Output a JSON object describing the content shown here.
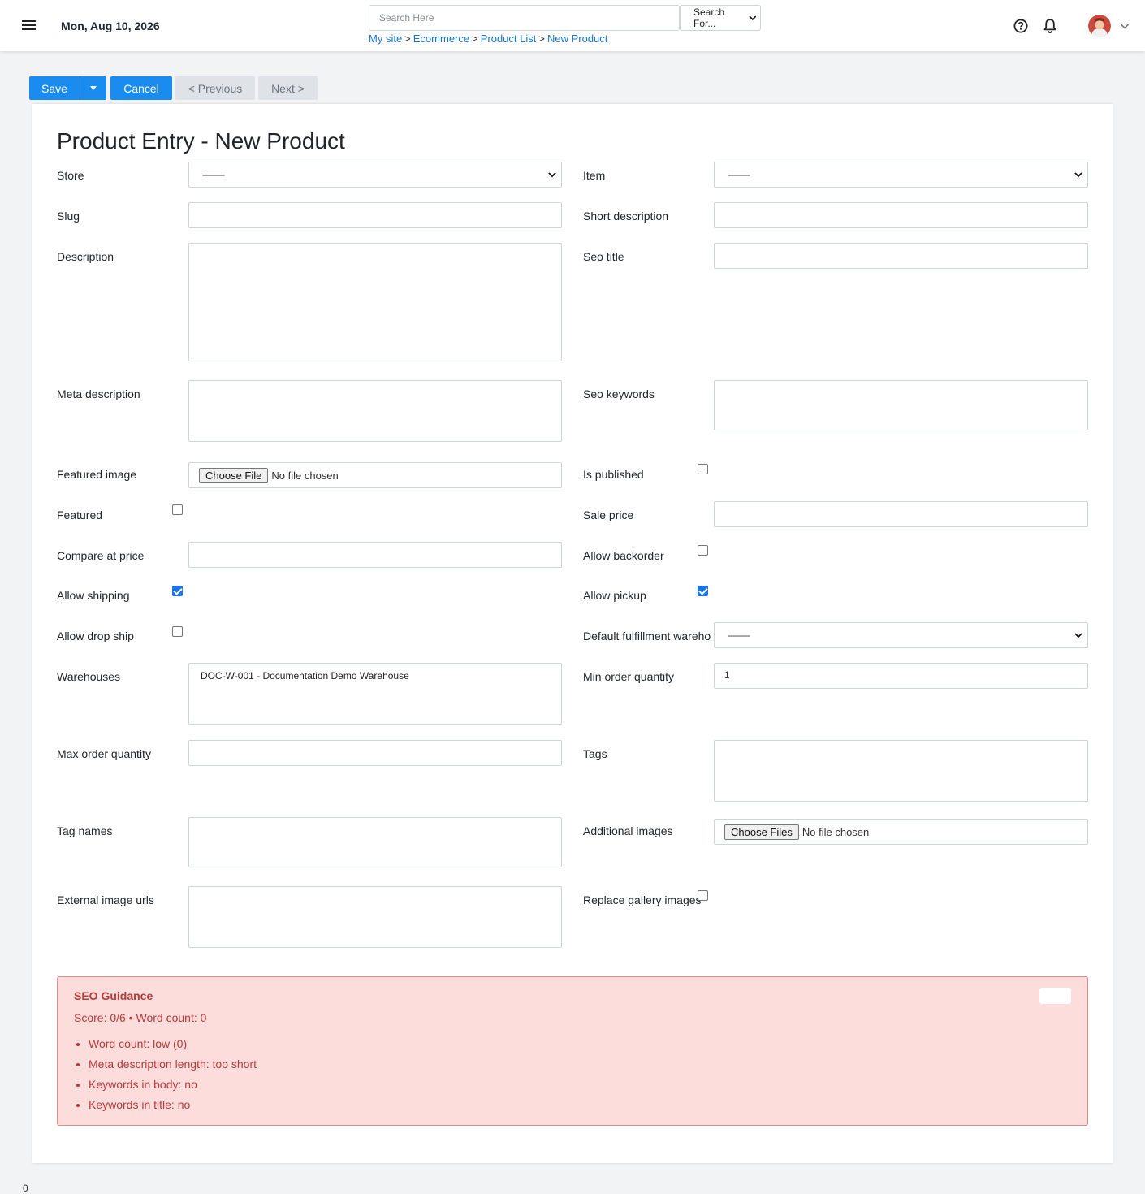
{
  "header": {
    "date": "Mon, Aug 10, 2026",
    "search_placeholder": "Search Here",
    "search_scope": "Search For...",
    "breadcrumb": [
      "My site",
      "Ecommerce",
      "Product List",
      "New Product"
    ],
    "breadcrumb_separator": ">"
  },
  "toolbar": {
    "save": "Save",
    "cancel": "Cancel",
    "previous": "< Previous",
    "next": "Next >"
  },
  "form": {
    "title": "Product Entry - New Product",
    "select_placeholder": "---------",
    "file_button": "Choose File",
    "files_button": "Choose Files",
    "no_file": "No file chosen",
    "labels": {
      "store": "Store",
      "item": "Item",
      "slug": "Slug",
      "short_description": "Short description",
      "description": "Description",
      "seo_title": "Seo title",
      "meta_description": "Meta description",
      "seo_keywords": "Seo keywords",
      "featured_image": "Featured image",
      "is_published": "Is published",
      "featured": "Featured",
      "sale_price": "Sale price",
      "compare_at_price": "Compare at price",
      "allow_backorder": "Allow backorder",
      "allow_shipping": "Allow shipping",
      "allow_pickup": "Allow pickup",
      "allow_drop_ship": "Allow drop ship",
      "default_fulfillment_warehouse": "Default fulfillment wareho",
      "warehouses": "Warehouses",
      "min_order_quantity": "Min order quantity",
      "max_order_quantity": "Max order quantity",
      "tags": "Tags",
      "tag_names": "Tag names",
      "additional_images": "Additional images",
      "external_image_urls": "External image urls",
      "replace_gallery_images": "Replace gallery images"
    },
    "values": {
      "warehouse_option": "DOC-W-001 - Documentation Demo Warehouse",
      "min_order_quantity": "1"
    },
    "checkboxes": {
      "is_published": false,
      "featured": false,
      "allow_backorder": false,
      "allow_shipping": true,
      "allow_pickup": true,
      "allow_drop_ship": false,
      "replace_gallery_images": false
    }
  },
  "seo": {
    "title": "SEO Guidance",
    "score_line": "Score: 0/6 • Word count: 0",
    "items": [
      "Word count: low (0)",
      "Meta description length: too short",
      "Keywords in body: no",
      "Keywords in title: no"
    ]
  },
  "footer_mark": "0",
  "colors": {
    "primary": "#1a8cf0",
    "link": "#1a73c9",
    "danger_bg": "#fddcdc",
    "danger_border": "#e08a8a",
    "danger_text": "#b73a3a"
  },
  "icons": [
    "hamburger-icon",
    "help-icon",
    "bell-icon",
    "avatar",
    "chevron-down-icon",
    "caret-down-icon"
  ]
}
